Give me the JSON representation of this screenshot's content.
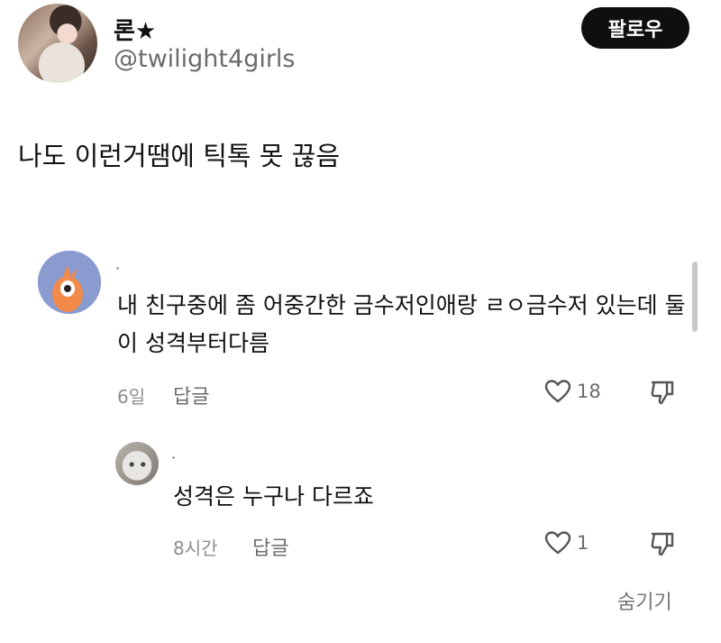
{
  "header": {
    "username": "론★",
    "handle": "@twilight4girls",
    "follow_label": "팔로우"
  },
  "post": {
    "text": "나도 이런거땜에 틱톡 못 끊음"
  },
  "comments": [
    {
      "author": "·",
      "avatar_color": "#8a9bd0",
      "text": "내 친구중에 좀 어중간한 금수저인애랑 ㄹㅇ금수저 있는데 둘이 성격부터다름",
      "time": "6일",
      "reply_label": "답글",
      "likes": "18"
    },
    {
      "author": "·",
      "text": "성격은 누구나 다르죠",
      "time": "8시간",
      "reply_label": "답글",
      "likes": "1"
    }
  ],
  "hide_label": "숨기기"
}
